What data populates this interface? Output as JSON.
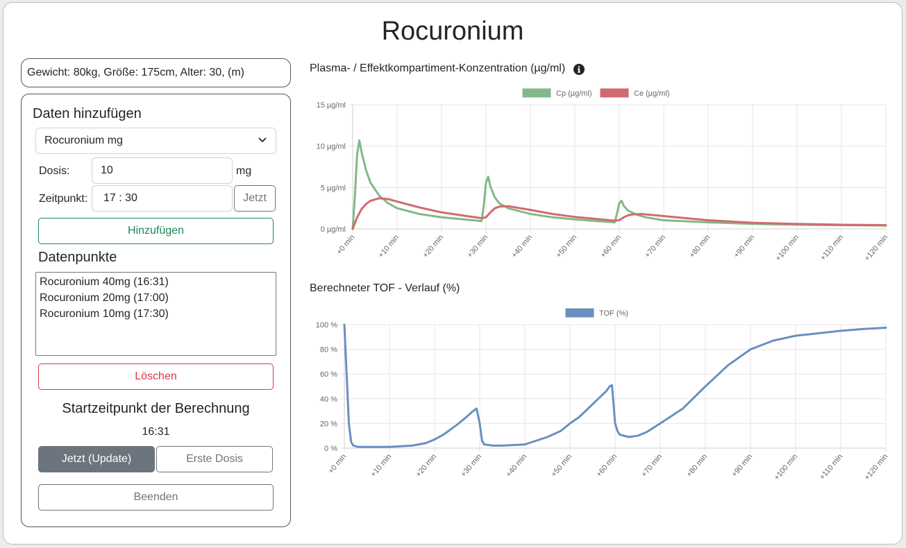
{
  "title": "Rocuronium",
  "patient": {
    "info": "Gewicht: 80kg, Größe: 175cm, Alter: 30, (m)"
  },
  "form": {
    "heading": "Daten hinzufügen",
    "drug_select": "Rocuronium mg",
    "dose_label": "Dosis:",
    "dose_value": "10",
    "dose_unit": "mg",
    "time_label": "Zeitpunkt:",
    "time_value": "17 : 30",
    "now_button": "Jetzt",
    "add_button": "Hinzufügen"
  },
  "datapoints": {
    "heading": "Datenpunkte",
    "items": [
      "Rocuronium 40mg (16:31)",
      "Rocuronium 20mg (17:00)",
      "Rocuronium 10mg (17:30)"
    ],
    "delete_button": "Löschen"
  },
  "start": {
    "heading": "Startzeitpunkt der Berechnung",
    "time": "16:31",
    "update_button": "Jetzt (Update)",
    "first_dose_button": "Erste Dosis",
    "end_button": "Beenden"
  },
  "colors": {
    "cp": "#82b887",
    "ce": "#d16a6e",
    "tof": "#6a8fc1",
    "success": "#198754",
    "danger": "#dc3545",
    "secondary": "#6c757d"
  },
  "icons": {
    "info": "info-circle-icon",
    "select": "chevron-down-icon"
  },
  "chart_data": [
    {
      "type": "line",
      "title": "Plasma- / Effektkompartiment-Konzentration (µg/ml)",
      "legend": "top",
      "grid": true,
      "ylim": [
        0,
        15
      ],
      "y_ticks": [
        "0 µg/ml",
        "5 µg/ml",
        "10 µg/ml",
        "15 µg/ml"
      ],
      "x_ticks": [
        "+0 min",
        "+10 min",
        "+20 min",
        "+30 min",
        "+40 min",
        "+50 min",
        "+60 min",
        "+70 min",
        "+80 min",
        "+90 min",
        "+100 min",
        "+110 min",
        "+120 min"
      ],
      "xlim": [
        0,
        120
      ],
      "series": [
        {
          "name": "Cp (µg/ml)",
          "x": [
            0,
            0.5,
            1,
            1.5,
            2,
            3,
            4,
            6,
            8,
            10,
            15,
            20,
            25,
            29,
            29.5,
            30,
            30.5,
            31,
            32,
            33,
            35,
            40,
            45,
            50,
            55,
            59,
            59.5,
            60,
            60.5,
            61,
            62,
            64,
            66,
            70,
            80,
            90,
            100,
            110,
            120
          ],
          "y": [
            0,
            4,
            9,
            10.7,
            9.3,
            7.1,
            5.6,
            4.0,
            3.1,
            2.5,
            1.8,
            1.4,
            1.15,
            0.95,
            2.8,
            5.6,
            6.3,
            5.1,
            3.8,
            3.1,
            2.5,
            1.8,
            1.4,
            1.15,
            0.95,
            0.8,
            1.9,
            3.1,
            3.4,
            2.8,
            2.2,
            1.7,
            1.4,
            1.05,
            0.8,
            0.6,
            0.5,
            0.45,
            0.4
          ]
        },
        {
          "name": "Ce (µg/ml)",
          "x": [
            0,
            1,
            2,
            3,
            4,
            6,
            8,
            10,
            15,
            20,
            25,
            29,
            30,
            31,
            32,
            33,
            35,
            40,
            45,
            50,
            55,
            59,
            60,
            61,
            62,
            63,
            65,
            70,
            80,
            90,
            100,
            110,
            120
          ],
          "y": [
            0,
            1.4,
            2.4,
            3.0,
            3.4,
            3.7,
            3.6,
            3.3,
            2.6,
            2.0,
            1.6,
            1.3,
            1.4,
            2.0,
            2.5,
            2.7,
            2.75,
            2.3,
            1.8,
            1.45,
            1.2,
            1.0,
            1.05,
            1.4,
            1.65,
            1.75,
            1.8,
            1.55,
            1.05,
            0.75,
            0.6,
            0.5,
            0.45
          ]
        }
      ]
    },
    {
      "type": "line",
      "title": "Berechneter TOF - Verlauf (%)",
      "legend": "top",
      "grid": true,
      "ylim": [
        0,
        100
      ],
      "y_ticks": [
        "0 %",
        "20 %",
        "40 %",
        "60 %",
        "80 %",
        "100 %"
      ],
      "x_ticks": [
        "+0 min",
        "+10 min",
        "+20 min",
        "+30 min",
        "+40 min",
        "+50 min",
        "+60 min",
        "+70 min",
        "+80 min",
        "+90 min",
        "+100 min",
        "+110 min",
        "+120 min"
      ],
      "xlim": [
        0,
        120
      ],
      "series": [
        {
          "name": "TOF (%)",
          "x": [
            0,
            0.5,
            1,
            1.5,
            2,
            3,
            5,
            8,
            10,
            15,
            18,
            20,
            22,
            25,
            27,
            28.5,
            29.3,
            30,
            30.5,
            31,
            33,
            35,
            40,
            45,
            48,
            50,
            52,
            54,
            56,
            58,
            58.8,
            59.3,
            60,
            60.5,
            61,
            63,
            65,
            67,
            70,
            75,
            80,
            85,
            90,
            95,
            100,
            105,
            110,
            115,
            120
          ],
          "y": [
            100,
            60,
            20,
            5,
            2,
            1,
            1,
            1,
            1,
            2,
            4,
            7,
            11,
            19,
            25,
            30,
            32,
            20,
            6,
            3,
            2,
            2,
            3,
            9,
            14,
            20,
            25,
            32,
            39,
            46,
            50,
            51,
            20,
            14,
            11,
            9,
            10,
            13,
            20,
            32,
            50,
            67,
            80,
            87,
            91,
            93,
            95,
            96.5,
            97.5
          ]
        }
      ]
    }
  ]
}
